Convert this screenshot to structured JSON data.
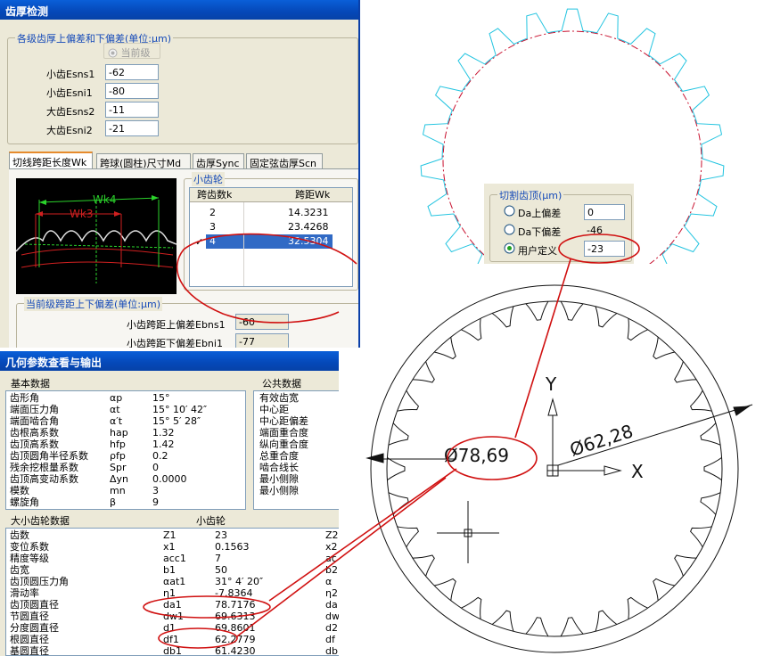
{
  "window1": {
    "title": "齿厚检测",
    "deviation_group": {
      "title": "各级齿厚上偏差和下偏差(单位:μm)",
      "current_level_label": "当前级",
      "fields": [
        {
          "label": "小齿Esns1",
          "value": "-62"
        },
        {
          "label": "小齿Esni1",
          "value": "-80"
        },
        {
          "label": "大齿Esns2",
          "value": "-11"
        },
        {
          "label": "大齿Esni2",
          "value": "-21"
        }
      ]
    },
    "tabs": [
      "切线跨距长度Wk",
      "跨球(圆柱)尺寸Md",
      "齿厚Sync",
      "固定弦齿厚Scn"
    ],
    "diagram": {
      "wk4": "Wk4",
      "wk3": "Wk3"
    },
    "pinion_group": {
      "title": "小齿轮",
      "columns": [
        "跨齿数k",
        "跨距Wk"
      ],
      "rows": [
        {
          "k": "2",
          "wk": "14.3231"
        },
        {
          "k": "3",
          "wk": "23.4268"
        },
        {
          "k": "4",
          "wk": "32.5304",
          "selected": true
        }
      ]
    },
    "span_group": {
      "title": "当前级跨距上下偏差(单位:μm)",
      "fields": [
        {
          "label": "小齿跨距上偏差Ebns1",
          "value": "-60"
        },
        {
          "label": "小齿跨距下偏差Ebni1",
          "value": "-77"
        }
      ]
    }
  },
  "window2": {
    "title": "几何参数查看与输出",
    "basic_header": "基本数据",
    "common_header": "公共数据",
    "basic_rows": [
      {
        "name": "齿形角",
        "sym": "αp",
        "val": "15°"
      },
      {
        "name": "端面压力角",
        "sym": "αt",
        "val": "15° 10′ 42″"
      },
      {
        "name": "端面啮合角",
        "sym": "α′t",
        "val": "15° 5′ 28″"
      },
      {
        "name": "齿根高系数",
        "sym": "hap",
        "val": "1.32"
      },
      {
        "name": "齿顶高系数",
        "sym": "hfp",
        "val": "1.42"
      },
      {
        "name": "齿顶圆角半径系数",
        "sym": "ρfp",
        "val": "0.2"
      },
      {
        "name": "残余挖根量系数",
        "sym": "Spr",
        "val": "0"
      },
      {
        "name": "齿顶高变动系数",
        "sym": "Δyn",
        "val": "0.0000"
      },
      {
        "name": "模数",
        "sym": "mn",
        "val": "3"
      },
      {
        "name": "螺旋角",
        "sym": "β",
        "val": "9"
      }
    ],
    "common_rows": [
      "有效齿宽",
      "中心距",
      "中心距偏差",
      "端面重合度",
      "纵向重合度",
      "总重合度",
      "啮合线长",
      "最小侧隙",
      "最小侧隙"
    ],
    "gear_header": "大小齿轮数据",
    "pinion_header": "小齿轮",
    "gear_rows": [
      {
        "name": "齿数",
        "sym": "Z1",
        "val": "23",
        "sym2": "Z2"
      },
      {
        "name": "变位系数",
        "sym": "x1",
        "val": "0.1563",
        "sym2": "x2"
      },
      {
        "name": "精度等级",
        "sym": "acc1",
        "val": "7",
        "sym2": "ac"
      },
      {
        "name": "齿宽",
        "sym": "b1",
        "val": "50",
        "sym2": "b2"
      },
      {
        "name": "齿顶圆压力角",
        "sym": "αat1",
        "val": "31° 4′ 20″",
        "sym2": "α"
      },
      {
        "name": "滑动率",
        "sym": "η1",
        "val": "-7.8364",
        "sym2": "η2"
      },
      {
        "name": "齿顶圆直径",
        "sym": "da1",
        "val": "78.7176",
        "sym2": "da"
      },
      {
        "name": "节圆直径",
        "sym": "dw1",
        "val": "69.6313",
        "sym2": "dw"
      },
      {
        "name": "分度圆直径",
        "sym": "d1",
        "val": "69.8601",
        "sym2": "d2"
      },
      {
        "name": "根圆直径",
        "sym": "df1",
        "val": "62.2779",
        "sym2": "df"
      },
      {
        "name": "基圆直径",
        "sym": "db1",
        "val": "61.4230",
        "sym2": "db"
      }
    ]
  },
  "cut_panel": {
    "title": "切割齿顶(μm)",
    "options": [
      {
        "label": "Da上偏差",
        "value": "0",
        "checked": false
      },
      {
        "label": "Da下偏差",
        "value": "-46",
        "checked": false
      },
      {
        "label": "用户定义",
        "value": "-23",
        "checked": true
      }
    ]
  },
  "drawing": {
    "dia_outer": "Ø78,69",
    "dia_root": "Ø62,28",
    "axis_y": "Y",
    "axis_x": "X"
  },
  "colors": {
    "annotation": "#d01010",
    "gear_outline": "#22c4e0",
    "titlebar": "#0a5fd8",
    "selection": "#316ac5"
  }
}
